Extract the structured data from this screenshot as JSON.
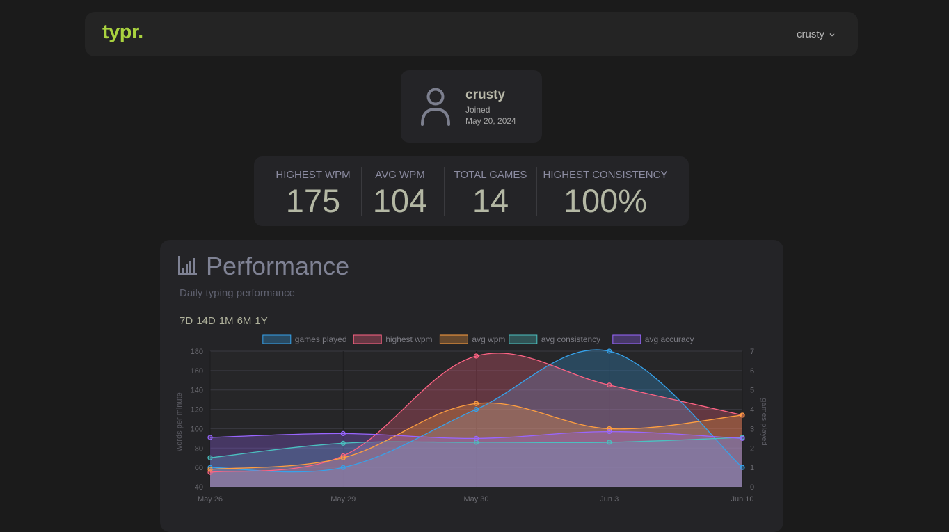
{
  "app": {
    "logo": "typr.",
    "accent": "#a9d23f"
  },
  "nav": {
    "username": "crusty"
  },
  "profile": {
    "name": "crusty",
    "joined_label": "Joined",
    "joined_date": "May 20, 2024"
  },
  "stats": [
    {
      "label": "HIGHEST WPM",
      "value": "175"
    },
    {
      "label": "AVG WPM",
      "value": "104"
    },
    {
      "label": "TOTAL GAMES",
      "value": "14"
    },
    {
      "label": "HIGHEST CONSISTENCY",
      "value": "100%"
    }
  ],
  "performance": {
    "title": "Performance",
    "subtitle": "Daily typing performance",
    "ranges": [
      "7D",
      "14D",
      "1M",
      "6M",
      "1Y"
    ],
    "active_range": "6M"
  },
  "chart_data": {
    "type": "line",
    "area": true,
    "categories": [
      "May 26",
      "May 29",
      "May 30",
      "Jun 3",
      "Jun 10"
    ],
    "series": [
      {
        "name": "games played",
        "axis": "right",
        "color": "#36a2eb",
        "values": [
          1,
          1,
          4,
          7,
          1
        ]
      },
      {
        "name": "highest wpm",
        "axis": "left",
        "color": "#ff6384",
        "values": [
          55,
          72,
          175,
          145,
          114
        ]
      },
      {
        "name": "avg wpm",
        "axis": "left",
        "color": "#ff9f40",
        "values": [
          58,
          70,
          126,
          100,
          114
        ]
      },
      {
        "name": "avg consistency",
        "axis": "left",
        "color": "#4bc0c0",
        "values": [
          70,
          85,
          86,
          86,
          91
        ]
      },
      {
        "name": "avg accuracy",
        "axis": "left",
        "color": "#9966ff",
        "values": [
          91,
          95,
          90,
          97,
          90
        ]
      }
    ],
    "ylabel": "words per minute",
    "y2label": "games played",
    "ylim": [
      40,
      180
    ],
    "yticks": [
      40,
      60,
      80,
      100,
      120,
      140,
      160,
      180
    ],
    "y2lim": [
      0,
      7
    ],
    "y2ticks": [
      0,
      1,
      2,
      3,
      4,
      5,
      6,
      7
    ],
    "grid": true,
    "legend": "top"
  }
}
